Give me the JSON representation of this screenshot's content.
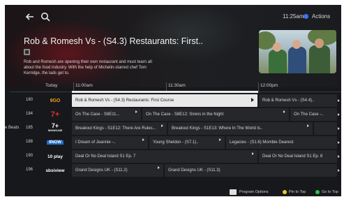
{
  "header": {
    "clock": "11:25am",
    "actions_label": "Actions"
  },
  "program": {
    "title": "Rob & Romesh Vs - (S4.3) Restaurants: First..",
    "description": "Rob and Romesh are opening their own restaurant and must learn all about the food industry. With the help of Michelin-starred chef Tom Kerridge, the lads get to."
  },
  "timeline": {
    "today": "Today",
    "times": [
      "11:00am",
      "11:30am",
      "12:00pm"
    ]
  },
  "channels": [
    {
      "number": "180",
      "logo": "9GO",
      "logo_color": "#f0a020",
      "programs": [
        {
          "title": "Rob & Romesh Vs - (S4.3) Restaurants: First Course",
          "selected": true
        },
        {
          "title": "Rob & Romesh Vs - (S4.4).."
        }
      ]
    },
    {
      "number": "184",
      "logo": "7+",
      "logo_color": "#e03030",
      "programs": [
        {
          "title": "On The Case - S8E11..."
        },
        {
          "title": "On The Case - S8E12: Sirens in the Night"
        },
        {
          "title": "On The Case -.."
        }
      ]
    },
    {
      "number": "185",
      "logo": "7+",
      "logo_color": "#ffffff",
      "sub_logo": "SHOWCASE",
      "left_text": "e Beats",
      "programs": [
        {
          "title": "Breakout Kings - S1E12: There Are Rules..."
        },
        {
          "title": "Breakout Kings - S1E13: Where In The World Is.."
        },
        {
          "title": "(S1.6) Mombie Dearest"
        }
      ]
    },
    {
      "number": "188",
      "logo": "9NOW",
      "logo_color": "#1e6fd0",
      "programs": [
        {
          "title": "I Dream of Jeannie -.."
        },
        {
          "title": "Young Sheldon - (S7.1).."
        },
        {
          "title": "Legacies - (S1.6) Mombie Dearest"
        }
      ]
    },
    {
      "number": "190",
      "logo": "10 play",
      "logo_color": "#1a80e8",
      "programs": [
        {
          "title": "Deal Or No Deal Island S1 Ep. 7"
        },
        {
          "title": "Deal Or No Deal Island S1 Ep. 8"
        }
      ]
    },
    {
      "number": "196",
      "logo": "sbsiview",
      "logo_color": "#ffffff",
      "programs": [
        {
          "title": "Grand Designs UK - (S11.2)"
        },
        {
          "title": "Grand Designs UK - (S11.3)"
        }
      ]
    }
  ],
  "footer": {
    "program_options": "Program Options",
    "pin_to_top": "Pin to Top",
    "go_to_top": "Go to Top"
  },
  "colors": {
    "accent_blue": "#3a74f0",
    "yellow": "#f2c81c",
    "green": "#2fbf4d"
  }
}
